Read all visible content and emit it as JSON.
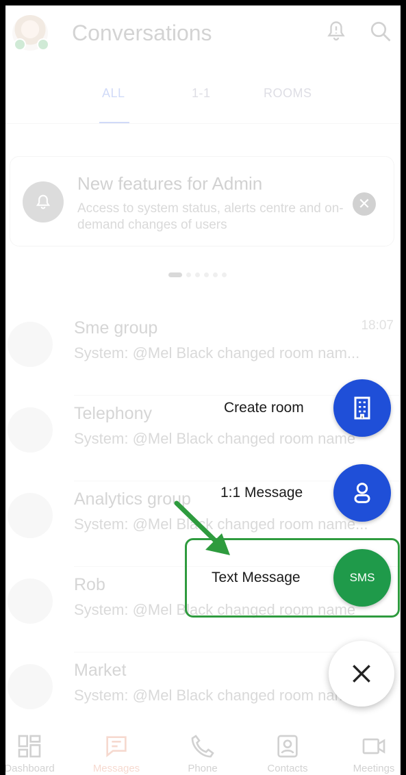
{
  "header": {
    "title": "Conversations",
    "bell_icon": "bell-alert-icon",
    "search_icon": "search-icon"
  },
  "tabs": [
    {
      "label": "ALL"
    },
    {
      "label": "1-1"
    },
    {
      "label": "ROOMS"
    }
  ],
  "banner": {
    "title": "New features for Admin",
    "text": "Access to system status, alerts centre and on-demand changes of users"
  },
  "conversations": [
    {
      "name": "Sme group",
      "message": "System: @Mel Black changed room nam...",
      "time": "18:07",
      "icon": "group-icon"
    },
    {
      "name": "Telephony",
      "message": "System: @Mel Black changed room name",
      "time": "",
      "icon": "group-icon"
    },
    {
      "name": "Analytics group",
      "message": "System: @Mel Black changed room name...",
      "time": "",
      "icon": "group-icon"
    },
    {
      "name": "Rob",
      "message": "System: @Mel Black changed room name",
      "time": "",
      "icon": "lock-icon"
    },
    {
      "name": "Market",
      "message": "System: @Mel Black changed room name",
      "time": "",
      "icon": "group-icon"
    }
  ],
  "fab_menu": {
    "create_room": "Create room",
    "one_to_one": "1:1 Message",
    "text_message": "Text Message",
    "sms_label": "SMS"
  },
  "bottom_nav": [
    {
      "label": "Dashboard",
      "icon": "dashboard-icon"
    },
    {
      "label": "Messages",
      "icon": "messages-icon"
    },
    {
      "label": "Phone",
      "icon": "phone-icon"
    },
    {
      "label": "Contacts",
      "icon": "contacts-icon"
    },
    {
      "label": "Meetings",
      "icon": "video-icon"
    }
  ],
  "colors": {
    "accent_blue": "#1f4fd8",
    "sms_green": "#1f9a4a",
    "highlight_green": "#2e9b3e"
  }
}
